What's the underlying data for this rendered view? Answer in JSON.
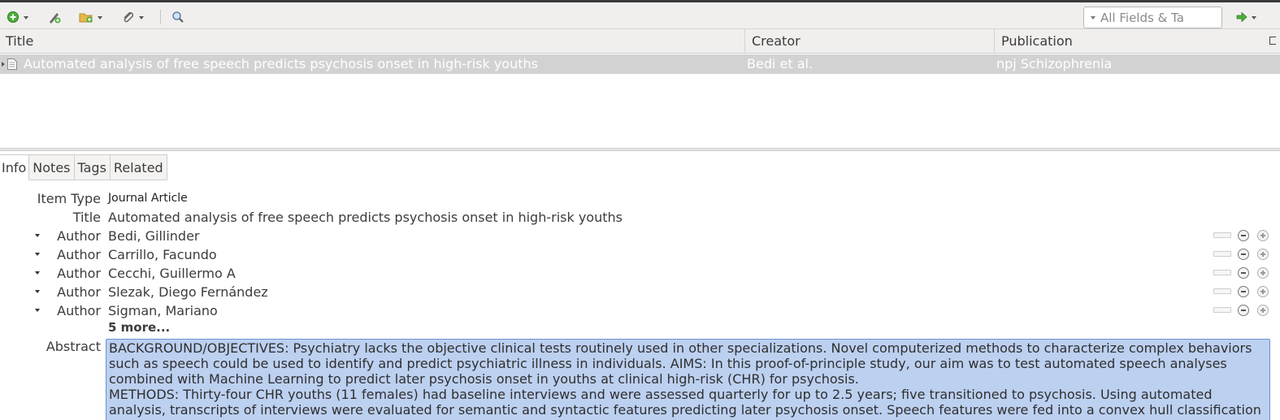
{
  "toolbar": {
    "icons": [
      "new-item-icon",
      "add-by-identifier-icon",
      "new-collection-icon",
      "attach-icon",
      "search-advanced-icon",
      "sync-arrow-icon"
    ],
    "search_placeholder": "All Fields & Ta"
  },
  "items_list": {
    "columns": [
      "Title",
      "Creator",
      "Publication"
    ],
    "rows": [
      {
        "title": "Automated analysis of free speech predicts psychosis onset in high-risk youths",
        "creator": "Bedi et al.",
        "publication": "npj Schizophrenia"
      }
    ]
  },
  "item_pane": {
    "tabs": [
      "Info",
      "Notes",
      "Tags",
      "Related"
    ],
    "active_tab": "Info",
    "item_type_label": "Item Type",
    "item_type": "Journal Article",
    "title_label": "Title",
    "title": "Automated analysis of free speech predicts psychosis onset in high-risk youths",
    "authors": [
      {
        "label": "Author",
        "name": "Bedi, Gillinder"
      },
      {
        "label": "Author",
        "name": "Carrillo, Facundo"
      },
      {
        "label": "Author",
        "name": "Cecchi, Guillermo A"
      },
      {
        "label": "Author",
        "name": "Slezak, Diego Fernández"
      },
      {
        "label": "Author",
        "name": "Sigman, Mariano"
      }
    ],
    "more_authors": "5 more...",
    "abstract_label": "Abstract",
    "abstract_lines": [
      "BACKGROUND/OBJECTIVES: Psychiatry lacks the objective clinical tests routinely used in other specializations. Novel computerized methods to characterize complex behaviors such as speech could be used to identify and predict psychiatric illness in individuals. AIMS: In this proof-of-principle study, our aim was to test automated speech analyses combined with Machine Learning to predict later psychosis onset in youths at clinical high-risk (CHR) for psychosis.",
      "METHODS: Thirty-four CHR youths (11 females) had baseline interviews and were assessed quarterly for up to 2.5 years; five transitioned to psychosis. Using automated analysis, transcripts of interviews were evaluated for semantic and syntactic features predicting later psychosis onset. Speech features were fed into a convex hull classification algorithm with"
    ]
  },
  "colors": {
    "selected_row": "#d2d2d2",
    "abstract_highlight": "#bcd0f0",
    "abstract_border": "#6b93d3",
    "toolbar_bg": "#f0efee"
  }
}
